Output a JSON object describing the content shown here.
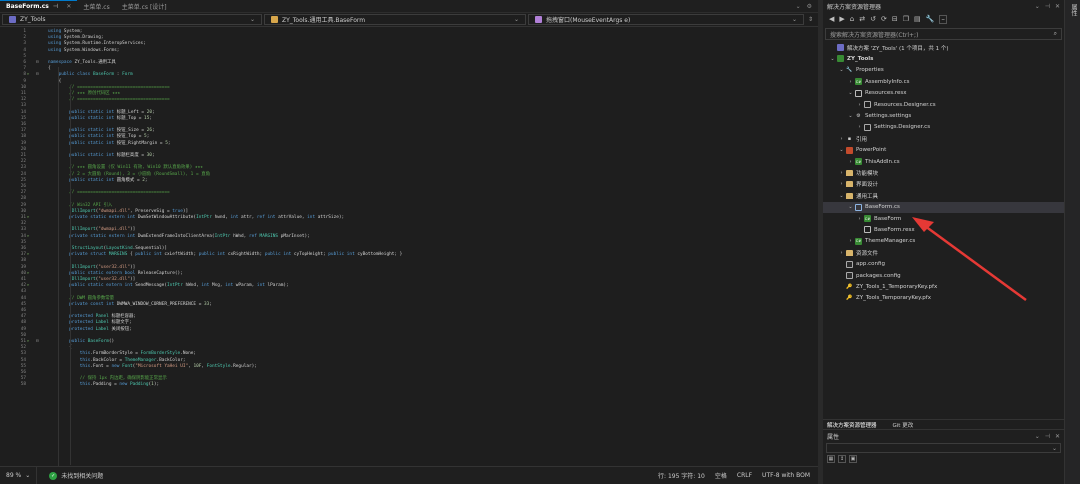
{
  "tabs": [
    {
      "label": "BaseForm.cs",
      "active": true
    },
    {
      "label": "主菜单.cs",
      "active": false
    },
    {
      "label": "主菜单.cs [设计]",
      "active": false
    }
  ],
  "navbar": {
    "project": "ZY_Tools",
    "class": "ZY_Tools.通用工具.BaseForm",
    "member": "拖拽窗口(MouseEventArgs e)"
  },
  "code_lines": [
    {
      "n": "1",
      "html": "<span class='k'>using</span> System;"
    },
    {
      "n": "2",
      "html": "<span class='k'>using</span> System.Drawing;"
    },
    {
      "n": "3",
      "html": "<span class='k'>using</span> System.Runtime.InteropServices;"
    },
    {
      "n": "4",
      "html": "<span class='k'>using</span> System.Windows.Forms;"
    },
    {
      "n": "5",
      "html": ""
    },
    {
      "n": "6",
      "html": "<span class='k'>namespace</span> ZY_Tools.通用工具"
    },
    {
      "n": "7",
      "html": "{"
    },
    {
      "n": "8",
      "html": "    <span class='k'>public class</span> <span class='t'>BaseForm</span> : <span class='t'>Form</span>"
    },
    {
      "n": "9",
      "html": "    {"
    },
    {
      "n": "10",
      "html": "        <span class='c'>// ===================================</span>"
    },
    {
      "n": "11",
      "html": "        <span class='c'>// ★★★ 原创代码区 ★★★</span>"
    },
    {
      "n": "12",
      "html": "        <span class='c'>// ===================================</span>"
    },
    {
      "n": "13",
      "html": ""
    },
    {
      "n": "14",
      "html": "        <span class='k'>public static int</span> 标题_Left = <span class='n'>20</span>;"
    },
    {
      "n": "15",
      "html": "        <span class='k'>public static int</span> 标题_Top = <span class='n'>15</span>;"
    },
    {
      "n": "16",
      "html": ""
    },
    {
      "n": "17",
      "html": "        <span class='k'>public static int</span> 按钮_Size = <span class='n'>26</span>;"
    },
    {
      "n": "18",
      "html": "        <span class='k'>public static int</span> 按钮_Top = <span class='n'>5</span>;"
    },
    {
      "n": "19",
      "html": "        <span class='k'>public static int</span> 按钮_RightMargin = <span class='n'>5</span>;"
    },
    {
      "n": "20",
      "html": ""
    },
    {
      "n": "21",
      "html": "        <span class='k'>public static int</span> 标题栏高度 = <span class='n'>30</span>;"
    },
    {
      "n": "22",
      "html": ""
    },
    {
      "n": "23",
      "html": "        <span class='c'>// ★★★ 圆角设置 (仅 Win11 有效, Win10 默认直角效果) ★★★</span>"
    },
    {
      "n": "24",
      "html": "        <span class='c'>// 2 = 大圆角 (Round), 3 = 小圆角 (RoundSmall), 1 = 直角</span>"
    },
    {
      "n": "25",
      "html": "        <span class='k'>public static int</span> 圆角模式 = <span class='n'>2</span>;"
    },
    {
      "n": "26",
      "html": ""
    },
    {
      "n": "27",
      "html": "        <span class='c'>// ===================================</span>"
    },
    {
      "n": "28",
      "html": ""
    },
    {
      "n": "29",
      "html": "        <span class='c'>// Win32 API 引入</span>"
    },
    {
      "n": "30",
      "html": "        [<span class='t'>DllImport</span>(<span class='s'>\"dwmapi.dll\"</span>, PreserveSig = <span class='k'>true</span>)]"
    },
    {
      "n": "31",
      "html": "        <span class='k'>private static extern int</span> DwmSetWindowAttribute(<span class='t'>IntPtr</span> hwnd, <span class='k'>int</span> attr, <span class='k'>ref int</span> attrValue, <span class='k'>int</span> attrSize);"
    },
    {
      "n": "32",
      "html": ""
    },
    {
      "n": "33",
      "html": "        [<span class='t'>DllImport</span>(<span class='s'>\"dwmapi.dll\"</span>)]"
    },
    {
      "n": "34",
      "html": "        <span class='k'>private static extern int</span> DwmExtendFrameIntoClientArea(<span class='t'>IntPtr</span> hWnd, <span class='k'>ref</span> <span class='t'>MARGINS</span> pMarInset);"
    },
    {
      "n": "35",
      "html": ""
    },
    {
      "n": "36",
      "html": "        [<span class='t'>StructLayout</span>(<span class='t'>LayoutKind</span>.Sequential)]"
    },
    {
      "n": "37",
      "html": "        <span class='k'>private struct</span> <span class='t'>MARGINS</span> { <span class='k'>public int</span> cxLeftWidth; <span class='k'>public int</span> cxRightWidth; <span class='k'>public int</span> cyTopHeight; <span class='k'>public int</span> cyBottomHeight; }"
    },
    {
      "n": "38",
      "html": ""
    },
    {
      "n": "39",
      "html": "        [<span class='t'>DllImport</span>(<span class='s'>\"user32.dll\"</span>)]"
    },
    {
      "n": "40",
      "html": "        <span class='k'>public static extern bool</span> ReleaseCapture();"
    },
    {
      "n": "41",
      "html": "        [<span class='t'>DllImport</span>(<span class='s'>\"user32.dll\"</span>)]"
    },
    {
      "n": "42",
      "html": "        <span class='k'>public static extern int</span> SendMessage(<span class='t'>IntPtr</span> hWnd, <span class='k'>int</span> Msg, <span class='k'>int</span> wParam, <span class='k'>int</span> lParam);"
    },
    {
      "n": "43",
      "html": ""
    },
    {
      "n": "44",
      "html": "        <span class='c'>// DWM 圆角参数常量</span>"
    },
    {
      "n": "45",
      "html": "        <span class='k'>private const int</span> DWMWA_WINDOW_CORNER_PREFERENCE = <span class='n'>33</span>;"
    },
    {
      "n": "46",
      "html": ""
    },
    {
      "n": "47",
      "html": "        <span class='k'>protected</span> <span class='t'>Panel</span> 标题栏容器;"
    },
    {
      "n": "48",
      "html": "        <span class='k'>protected</span> <span class='t'>Label</span> 标题文字;"
    },
    {
      "n": "49",
      "html": "        <span class='k'>protected</span> <span class='t'>Label</span> 关闭按钮;"
    },
    {
      "n": "50",
      "html": ""
    },
    {
      "n": "51",
      "html": "        <span class='k'>public</span> <span class='t'>BaseForm</span>()"
    },
    {
      "n": "52",
      "html": "        {"
    },
    {
      "n": "53",
      "html": "            <span class='k'>this</span>.FormBorderStyle = <span class='t'>FormBorderStyle</span>.None;"
    },
    {
      "n": "54",
      "html": "            <span class='k'>this</span>.BackColor = <span class='t'>ThemeManager</span>.BackColor;"
    },
    {
      "n": "55",
      "html": "            <span class='k'>this</span>.Font = <span class='k'>new</span> <span class='t'>Font</span>(<span class='s'>\"Microsoft YaHei UI\"</span>, <span class='n'>10F</span>, <span class='t'>FontStyle</span>.Regular);"
    },
    {
      "n": "56",
      "html": ""
    },
    {
      "n": "57",
      "html": "            <span class='c'>// 保持 1px 内边距，确保阴影能正常显示</span>"
    },
    {
      "n": "58",
      "html": "            <span class='k'>this</span>.Padding = <span class='k'>new</span> <span class='t'>Padding</span>(<span class='n'>1</span>);"
    }
  ],
  "ref_lines": [
    "8",
    "31",
    "34",
    "37",
    "40",
    "42",
    "51"
  ],
  "status": {
    "zoom": "89 %",
    "issues": "未找到相关问题",
    "position": "行: 195  字符: 10",
    "mode": "空格",
    "eol": "CRLF",
    "encoding": "UTF-8 with BOM"
  },
  "solution_explorer": {
    "title": "解决方案资源管理器",
    "search_placeholder": "搜索解决方案资源管理器(Ctrl+;)",
    "nodes": [
      {
        "label": "解决方案 'ZY_Tools' (1 个项目，共 1 个)",
        "depth": 0,
        "arrow": "",
        "icon": "sln",
        "iconText": ""
      },
      {
        "label": "ZY_Tools",
        "depth": 0,
        "arrow": "⌄",
        "icon": "proj",
        "iconText": "",
        "bold": true
      },
      {
        "label": "Properties",
        "depth": 1,
        "arrow": "⌄",
        "icon": "wrench",
        "iconText": "🔧"
      },
      {
        "label": "AssemblyInfo.cs",
        "depth": 2,
        "arrow": "›",
        "icon": "cs",
        "iconText": "C#"
      },
      {
        "label": "Resources.resx",
        "depth": 2,
        "arrow": "⌄",
        "icon": "resx",
        "iconText": ""
      },
      {
        "label": "Resources.Designer.cs",
        "depth": 3,
        "arrow": "›",
        "icon": "doc",
        "iconText": ""
      },
      {
        "label": "Settings.settings",
        "depth": 2,
        "arrow": "⌄",
        "icon": "gear",
        "iconText": "⚙"
      },
      {
        "label": "Settings.Designer.cs",
        "depth": 3,
        "arrow": "›",
        "icon": "doc",
        "iconText": ""
      },
      {
        "label": "引用",
        "depth": 1,
        "arrow": "›",
        "icon": "ref",
        "iconText": "▪"
      },
      {
        "label": "PowerPoint",
        "depth": 1,
        "arrow": "⌄",
        "icon": "ppt",
        "iconText": ""
      },
      {
        "label": "ThisAddIn.cs",
        "depth": 2,
        "arrow": "›",
        "icon": "cs",
        "iconText": "C#"
      },
      {
        "label": "功能模块",
        "depth": 1,
        "arrow": "›",
        "icon": "folder",
        "iconText": ""
      },
      {
        "label": "界面设计",
        "depth": 1,
        "arrow": "›",
        "icon": "folder",
        "iconText": ""
      },
      {
        "label": "通用工具",
        "depth": 1,
        "arrow": "⌄",
        "icon": "folder",
        "iconText": ""
      },
      {
        "label": "BaseForm.cs",
        "depth": 2,
        "arrow": "⌄",
        "icon": "form",
        "iconText": "",
        "selected": true
      },
      {
        "label": "BaseForm",
        "depth": 3,
        "arrow": "›",
        "icon": "cs",
        "iconText": "C#"
      },
      {
        "label": "BaseForm.resx",
        "depth": 3,
        "arrow": "",
        "icon": "resx",
        "iconText": ""
      },
      {
        "label": "ThemeManager.cs",
        "depth": 2,
        "arrow": "›",
        "icon": "cs",
        "iconText": "C#"
      },
      {
        "label": "资源文件",
        "depth": 1,
        "arrow": "›",
        "icon": "folder",
        "iconText": ""
      },
      {
        "label": "app.config",
        "depth": 1,
        "arrow": "",
        "icon": "cfg",
        "iconText": ""
      },
      {
        "label": "packages.config",
        "depth": 1,
        "arrow": "",
        "icon": "cfg",
        "iconText": ""
      },
      {
        "label": "ZY_Tools_1_TemporaryKey.pfx",
        "depth": 1,
        "arrow": "",
        "icon": "key",
        "iconText": "🔑"
      },
      {
        "label": "ZY_Tools_TemporaryKey.pfx",
        "depth": 1,
        "arrow": "",
        "icon": "key",
        "iconText": "🔑"
      }
    ]
  },
  "bottom_tabs": {
    "solution": "解决方案资源管理器",
    "git": "Git 更改"
  },
  "properties": {
    "title": "属性"
  },
  "right_strip": {
    "label": "属性"
  },
  "colors": {
    "accent": "#007acc",
    "selection": "#37373d",
    "annotation_arrow": "#e53935"
  }
}
